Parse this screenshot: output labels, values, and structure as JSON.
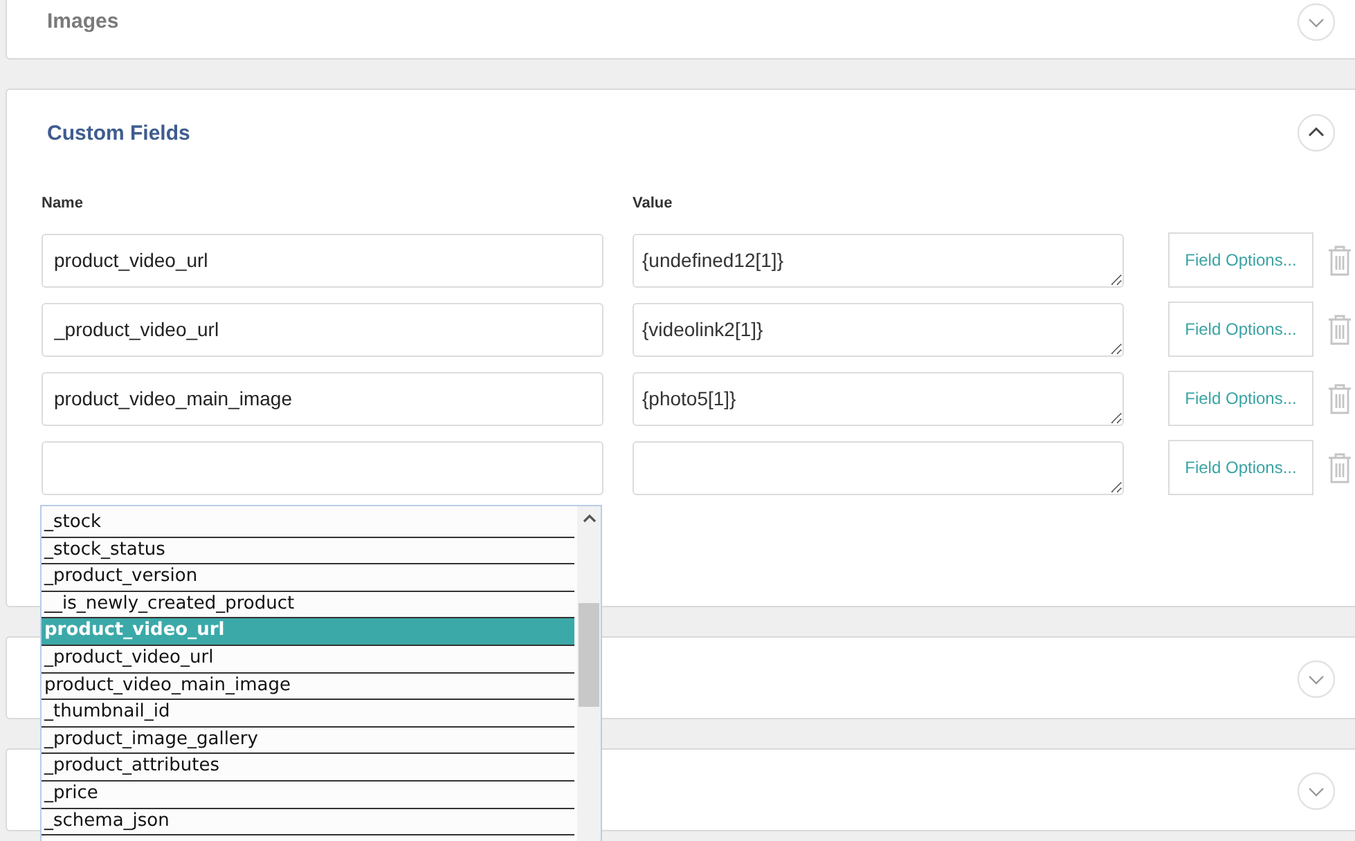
{
  "panels": [
    {
      "title": "Images",
      "expanded": false
    },
    {
      "title": "Custom Fields",
      "expanded": true,
      "columns": [
        "Name",
        "Value"
      ],
      "rows": [
        {
          "name": "product_video_url",
          "value": "{undefined12[1]}",
          "button": "Field Options..."
        },
        {
          "name": "_product_video_url",
          "value": "{videolink2[1]}",
          "button": "Field Options..."
        },
        {
          "name": "product_video_main_image",
          "value": "{photo5[1]}",
          "button": "Field Options..."
        },
        {
          "button": "Field Options..."
        }
      ]
    },
    {
      "expanded": false
    },
    {
      "expanded": false
    }
  ],
  "suggestions": [
    {
      "label": "_stock",
      "selected": false
    },
    {
      "label": "_stock_status",
      "selected": false
    },
    {
      "label": "_product_version",
      "selected": false
    },
    {
      "label": "__is_newly_created_product",
      "selected": false
    },
    {
      "label": "product_video_url",
      "selected": true
    },
    {
      "label": "_product_video_url",
      "selected": false
    },
    {
      "label": "product_video_main_image",
      "selected": false
    },
    {
      "label": "_thumbnail_id",
      "selected": false
    },
    {
      "label": "_product_image_gallery",
      "selected": false
    },
    {
      "label": "_product_attributes",
      "selected": false
    },
    {
      "label": "_price",
      "selected": false
    },
    {
      "label": "_schema_json",
      "selected": false
    }
  ]
}
